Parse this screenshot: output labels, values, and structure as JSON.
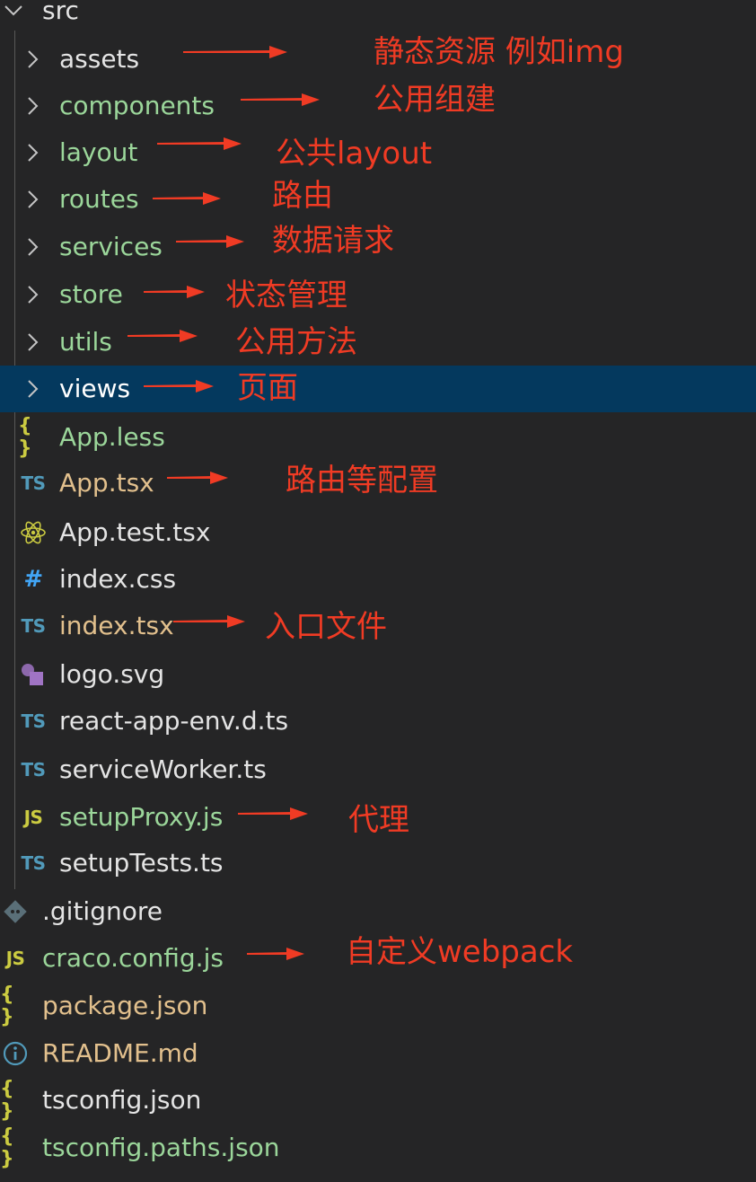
{
  "explorer": {
    "root": {
      "label": "src"
    },
    "folders": [
      {
        "label": "assets",
        "color": "#e4e4e4"
      },
      {
        "label": "components",
        "color": "#9bd69a"
      },
      {
        "label": "layout",
        "color": "#9bd69a"
      },
      {
        "label": "routes",
        "color": "#9bd69a"
      },
      {
        "label": "services",
        "color": "#9bd69a"
      },
      {
        "label": "store",
        "color": "#9bd69a"
      },
      {
        "label": "utils",
        "color": "#9bd69a"
      },
      {
        "label": "views",
        "color": "#ffffff"
      }
    ],
    "src_files": [
      {
        "label": "App.less",
        "icon": "{ }",
        "icon_name": "braces-icon",
        "color": "#9bd69a"
      },
      {
        "label": "App.tsx",
        "icon": "TS",
        "icon_name": "typescript-icon",
        "color": "#e2c08d"
      },
      {
        "label": "App.test.tsx",
        "icon": "",
        "icon_name": "react-icon",
        "color": "#e4e4e4"
      },
      {
        "label": "index.css",
        "icon": "#",
        "icon_name": "hash-icon",
        "color": "#e4e4e4"
      },
      {
        "label": "index.tsx",
        "icon": "TS",
        "icon_name": "typescript-icon",
        "color": "#e2c08d"
      },
      {
        "label": "logo.svg",
        "icon": "",
        "icon_name": "svg-shapes-icon",
        "color": "#e4e4e4"
      },
      {
        "label": "react-app-env.d.ts",
        "icon": "TS",
        "icon_name": "typescript-icon",
        "color": "#e4e4e4"
      },
      {
        "label": "serviceWorker.ts",
        "icon": "TS",
        "icon_name": "typescript-icon",
        "color": "#e4e4e4"
      },
      {
        "label": "setupProxy.js",
        "icon": "JS",
        "icon_name": "javascript-icon",
        "color": "#9bd69a"
      },
      {
        "label": "setupTests.ts",
        "icon": "TS",
        "icon_name": "typescript-icon",
        "color": "#e4e4e4"
      }
    ],
    "root_files": [
      {
        "label": ".gitignore",
        "icon": "",
        "icon_name": "git-icon",
        "color": "#e4e4e4"
      },
      {
        "label": "craco.config.js",
        "icon": "JS",
        "icon_name": "javascript-icon",
        "color": "#9bd69a"
      },
      {
        "label": "package.json",
        "icon": "{ }",
        "icon_name": "braces-icon",
        "color": "#e2c08d"
      },
      {
        "label": "README.md",
        "icon": "",
        "icon_name": "info-icon",
        "color": "#e2c08d"
      },
      {
        "label": "tsconfig.json",
        "icon": "{ }",
        "icon_name": "braces-icon",
        "color": "#e4e4e4"
      },
      {
        "label": "tsconfig.paths.json",
        "icon": "{ }",
        "icon_name": "braces-icon",
        "color": "#9bd69a"
      }
    ]
  },
  "annotations": [
    {
      "text": "静态资源 例如img"
    },
    {
      "text": "公用组建"
    },
    {
      "text": "公共layout"
    },
    {
      "text": "路由"
    },
    {
      "text": "数据请求"
    },
    {
      "text": "状态管理"
    },
    {
      "text": "公用方法"
    },
    {
      "text": "页面"
    },
    {
      "text": "路由等配置"
    },
    {
      "text": "入口文件"
    },
    {
      "text": "代理"
    },
    {
      "text": "自定义webpack"
    }
  ],
  "colors": {
    "background": "#252526",
    "selection": "#04395e",
    "annotation_red": "#f03b24",
    "ts_blue": "#519aba",
    "js_yellow": "#cbcb41",
    "json_yellow": "#cbcb41",
    "css_blue": "#42a5f5",
    "svg_purple": "#a074c4",
    "git_gray": "#41535b"
  }
}
